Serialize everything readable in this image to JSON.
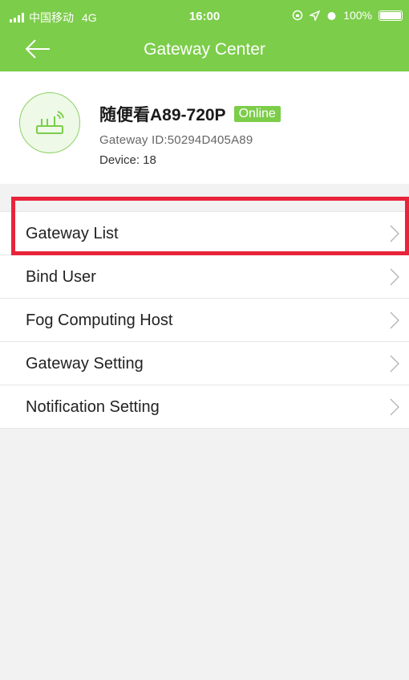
{
  "status_bar": {
    "carrier": "中国移动",
    "network": "4G",
    "time": "16:00",
    "battery": "100%"
  },
  "header": {
    "title": "Gateway Center",
    "back_icon": "arrow-left-icon"
  },
  "gateway": {
    "name": "随便看A89-720P",
    "status": "Online",
    "id_text": "Gateway ID:50294D405A89",
    "device_text": "Device: 18",
    "icon": "router-icon"
  },
  "menu": {
    "items": [
      {
        "label": "Gateway List"
      },
      {
        "label": "Bind User"
      },
      {
        "label": "Fog Computing Host"
      },
      {
        "label": "Gateway Setting"
      },
      {
        "label": "Notification Setting"
      }
    ]
  },
  "colors": {
    "brand_green": "#7ccd4a",
    "highlight_red": "#e8243b"
  }
}
